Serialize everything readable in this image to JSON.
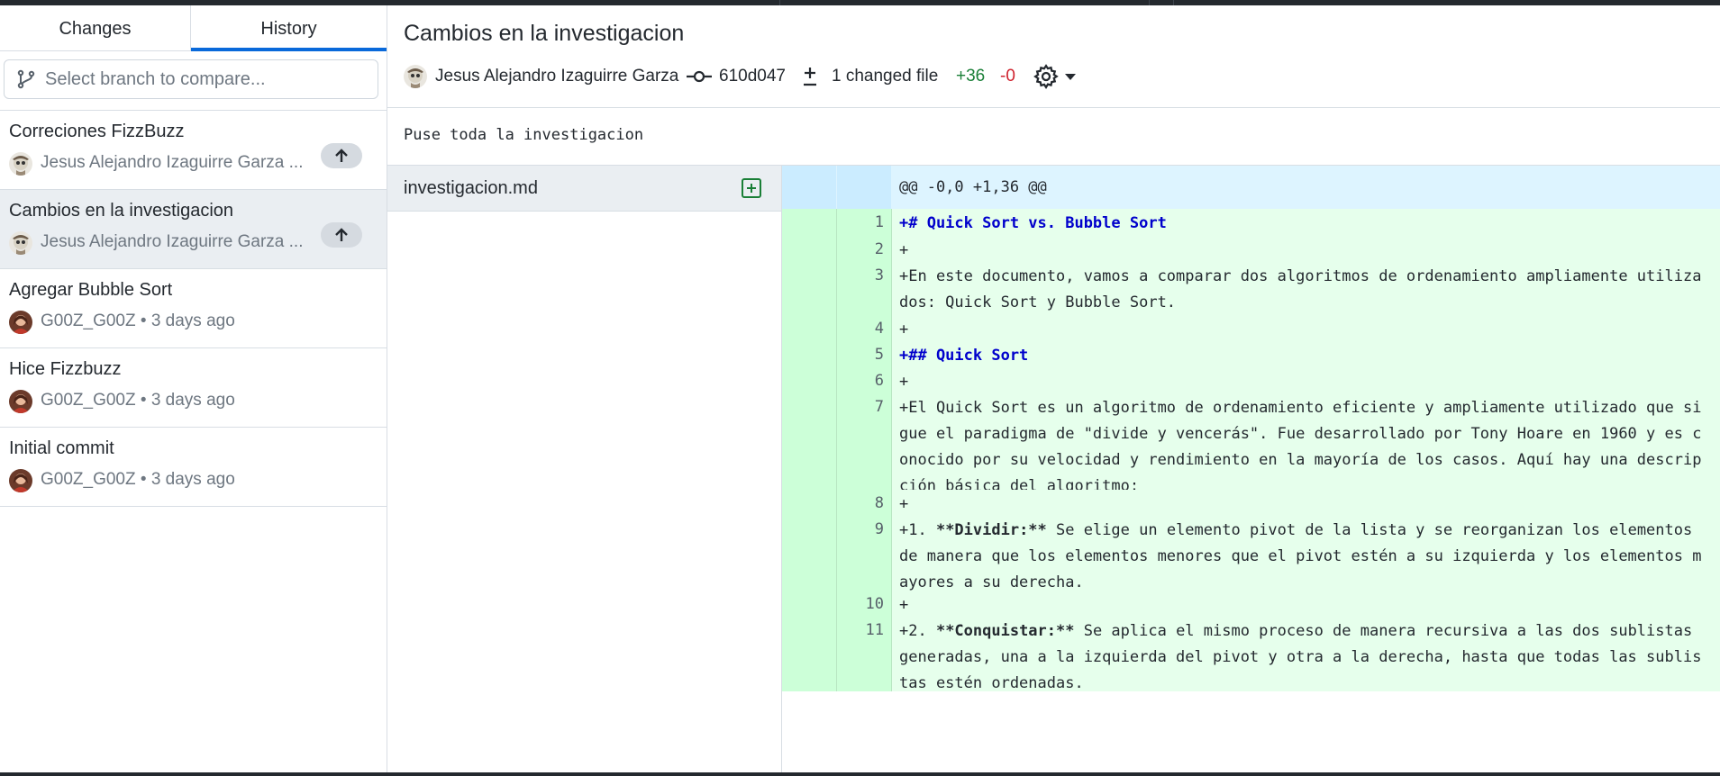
{
  "tabs": [
    {
      "label": "Changes",
      "active": false
    },
    {
      "label": "History",
      "active": true
    }
  ],
  "branch_compare": {
    "placeholder": "Select branch to compare..."
  },
  "commits": [
    {
      "title": "Correciones FizzBuzz",
      "meta": "Jesus Alejandro Izaguirre Garza ...",
      "unpushed": true,
      "selected": false,
      "avatar": "pirate-avatar"
    },
    {
      "title": "Cambios en la investigacion",
      "meta": "Jesus Alejandro Izaguirre Garza ...",
      "unpushed": true,
      "selected": true,
      "avatar": "pirate-avatar"
    },
    {
      "title": "Agregar Bubble Sort",
      "meta": "G00Z_G00Z • 3 days ago",
      "unpushed": false,
      "selected": false,
      "avatar": "portrait-avatar"
    },
    {
      "title": "Hice Fizzbuzz",
      "meta": "G00Z_G00Z • 3 days ago",
      "unpushed": false,
      "selected": false,
      "avatar": "portrait-avatar"
    },
    {
      "title": "Initial commit",
      "meta": "G00Z_G00Z • 3 days ago",
      "unpushed": false,
      "selected": false,
      "avatar": "portrait-avatar"
    }
  ],
  "commit_detail": {
    "title": "Cambios en la investigacion",
    "author": "Jesus Alejandro Izaguirre Garza",
    "sha": "610d047",
    "files_changed": "1 changed file",
    "additions": "+36",
    "deletions": "-0",
    "message": "Puse toda la investigacion"
  },
  "files": [
    {
      "name": "investigacion.md",
      "status": "added"
    }
  ],
  "diff": {
    "hunk_header": "@@ -0,0 +1,36 @@",
    "lines": [
      {
        "num": "1",
        "text": "+# Quick Sort vs. Bubble Sort",
        "style": "heading"
      },
      {
        "num": "2",
        "text": "+",
        "style": "plain"
      },
      {
        "num": "3",
        "text": "+En este documento, vamos a comparar dos algoritmos de ordenamiento ampliamente utilizados: Quick Sort y Bubble Sort.",
        "style": "plain"
      },
      {
        "num": "4",
        "text": "+",
        "style": "plain"
      },
      {
        "num": "5",
        "text": "+## Quick Sort",
        "style": "heading"
      },
      {
        "num": "6",
        "text": "+",
        "style": "plain"
      },
      {
        "num": "7",
        "text": "+El Quick Sort es un algoritmo de ordenamiento eficiente y ampliamente utilizado que sigue el paradigma de \"divide y vencerás\". Fue desarrollado por Tony Hoare en 1960 y es conocido por su velocidad y rendimiento en la mayoría de los casos. Aquí hay una descripción básica del algoritmo:",
        "style": "plain"
      },
      {
        "num": "8",
        "text": "+",
        "style": "plain"
      },
      {
        "num": "9",
        "prefix": "+1. ",
        "bold": "**Dividir:**",
        "text": " Se elige un elemento pivot de la lista y se reorganizan los elementos de manera que los elementos menores que el pivot estén a su izquierda y los elementos mayores a su derecha.",
        "style": "bold"
      },
      {
        "num": "10",
        "text": "+",
        "style": "plain"
      },
      {
        "num": "11",
        "prefix": "+2. ",
        "bold": "**Conquistar:**",
        "text": " Se aplica el mismo proceso de manera recursiva a las dos sublistas generadas, una a la izquierda del pivot y otra a la derecha, hasta que todas las sublistas estén ordenadas.",
        "style": "bold"
      }
    ]
  },
  "colors": {
    "accent": "#0969da",
    "added": "#1a7f37",
    "deleted": "#cf222e",
    "diff_add_bg": "#e6ffec",
    "diff_gutter_bg": "#ccffd8",
    "selected_row": "#eaeef2"
  }
}
